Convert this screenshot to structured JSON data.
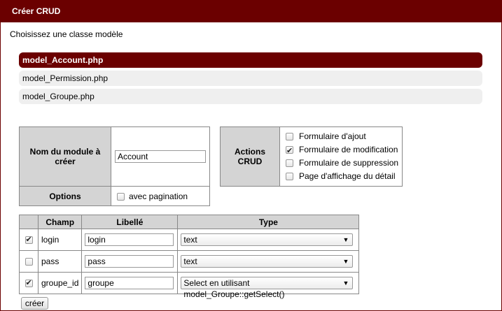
{
  "window": {
    "title": "Créer CRUD"
  },
  "prompt": "Choisissez une classe modèle",
  "models": [
    {
      "label": "model_Account.php",
      "selected": true
    },
    {
      "label": "model_Permission.php",
      "selected": false
    },
    {
      "label": "model_Groupe.php",
      "selected": false
    }
  ],
  "module": {
    "name_label": "Nom du module à créer",
    "name_value": "Account",
    "options_label": "Options",
    "pagination_label": "avec pagination",
    "pagination_checked": false
  },
  "actions": {
    "label": "Actions CRUD",
    "items": [
      {
        "label": "Formulaire d'ajout",
        "checked": false
      },
      {
        "label": "Formulaire de modification",
        "checked": true
      },
      {
        "label": "Formulaire de suppression",
        "checked": false
      },
      {
        "label": "Page d'affichage du détail",
        "checked": false
      }
    ]
  },
  "fields_table": {
    "headers": [
      "",
      "Champ",
      "Libellé",
      "Type"
    ],
    "rows": [
      {
        "checked": true,
        "champ": "login",
        "libelle": "login",
        "type": "text"
      },
      {
        "checked": false,
        "champ": "pass",
        "libelle": "pass",
        "type": "text"
      },
      {
        "checked": true,
        "champ": "groupe_id",
        "libelle": "groupe",
        "type": "Select en utilisant model_Groupe::getSelect()"
      }
    ]
  },
  "submit_label": "créer",
  "colors": {
    "accent": "#6b0000",
    "label_bg": "#d4d4d4",
    "model_bg": "#efefef"
  },
  "icons": {
    "checkbox_checked": "checkmark-icon",
    "dropdown": "chevron-down-icon"
  }
}
